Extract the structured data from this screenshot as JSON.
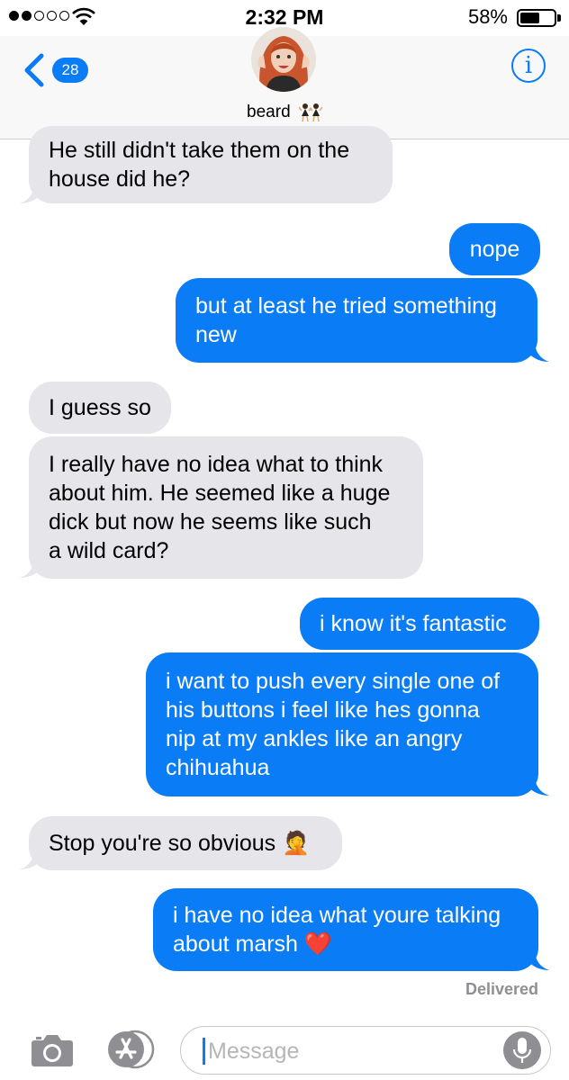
{
  "status_bar": {
    "time": "2:32 PM",
    "battery_percent": "58%",
    "battery_level": 0.58,
    "signal_bars": 2
  },
  "header": {
    "back_badge": "28",
    "contact_name": "beard",
    "info_glyph": "i"
  },
  "messages": [
    {
      "direction": "incoming",
      "text_lines": [
        "He still didn't take them on the",
        "house did he?"
      ]
    },
    {
      "direction": "outgoing",
      "text_lines": [
        "nope"
      ]
    },
    {
      "direction": "outgoing",
      "text_lines": [
        "but at least he tried something",
        "new"
      ]
    },
    {
      "direction": "incoming",
      "text_lines": [
        "I guess so"
      ]
    },
    {
      "direction": "incoming",
      "text_lines": [
        "I really have no idea what to think",
        "about him. He seemed like a huge",
        "dick but now he seems like such",
        "a wild card?"
      ]
    },
    {
      "direction": "outgoing",
      "text_lines": [
        "i know it's fantastic"
      ]
    },
    {
      "direction": "outgoing",
      "text_lines": [
        "i want to push every single one of",
        "his buttons i feel like hes gonna",
        "nip at my ankles like an angry",
        "chihuahua"
      ]
    },
    {
      "direction": "incoming",
      "text_lines": [
        "Stop you're so obvious 🤦"
      ]
    },
    {
      "direction": "outgoing",
      "text_lines": [
        "i have no idea what youre talking",
        "about marsh ❤️"
      ]
    }
  ],
  "delivered_label": "Delivered",
  "input": {
    "placeholder": "Message"
  },
  "colors": {
    "outgoing": "#0a7cf5",
    "incoming": "#e5e5ea",
    "accent": "#0a7cf5"
  },
  "icons": [
    "camera-icon",
    "app-store-icon",
    "microphone-icon",
    "back-chevron-icon",
    "info-icon"
  ]
}
